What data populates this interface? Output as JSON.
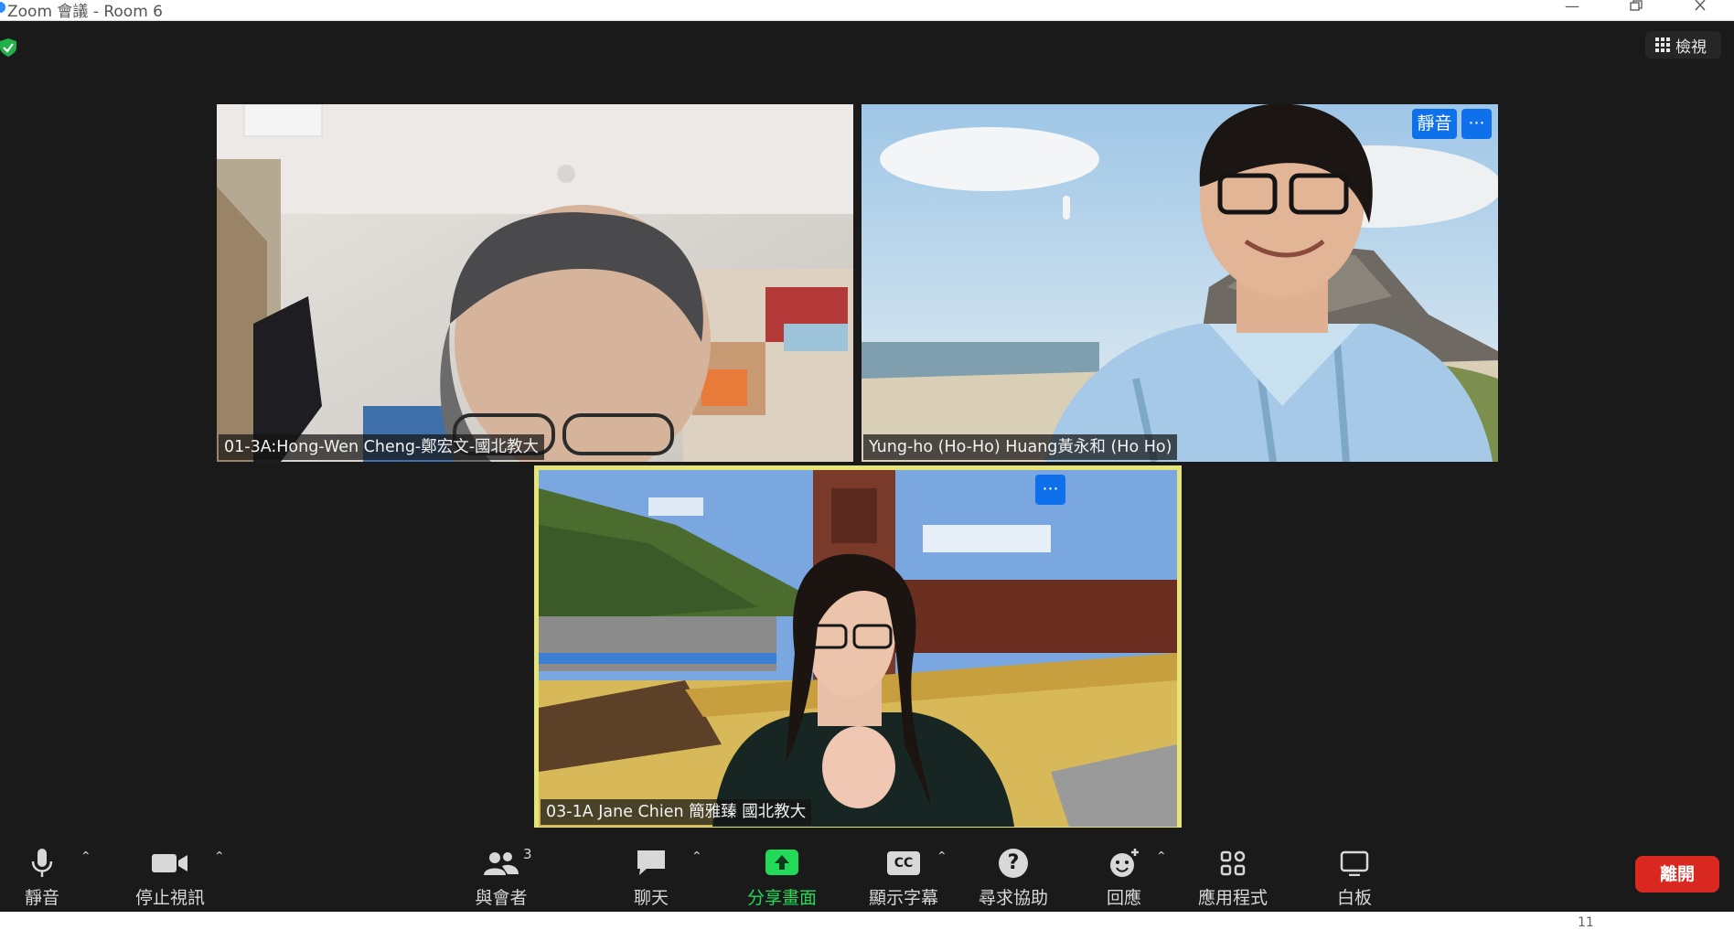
{
  "window": {
    "title": "Zoom 會議 - Room 6"
  },
  "view_button": {
    "label": "檢視",
    "icon": "grid-icon"
  },
  "participants": [
    {
      "name": "01-3A:Hong-Wen Cheng-鄭宏文-國北教大"
    },
    {
      "name": "Yung-ho (Ho-Ho) Huang黃永和 (Ho Ho)",
      "mute_label": "靜音",
      "more_label": "···"
    },
    {
      "name": "03-1A Jane Chien 簡雅臻 國北教大",
      "more_label": "···",
      "active_speaker": true
    }
  ],
  "toolbar": {
    "mute": "靜音",
    "stop_video": "停止視訊",
    "participants": "與會者",
    "participants_count": "3",
    "chat": "聊天",
    "share_screen": "分享畫面",
    "captions": "顯示字幕",
    "captions_icon_text": "CC",
    "help": "尋求協助",
    "reactions": "回應",
    "apps": "應用程式",
    "whiteboard": "白板",
    "leave": "離開"
  },
  "colors": {
    "meeting_bg": "#1a1a1a",
    "accent_blue": "#0e71eb",
    "share_green": "#23d959",
    "leave_red": "#d9281f",
    "speaker_border": "#e6e377"
  },
  "footer_text": "11"
}
